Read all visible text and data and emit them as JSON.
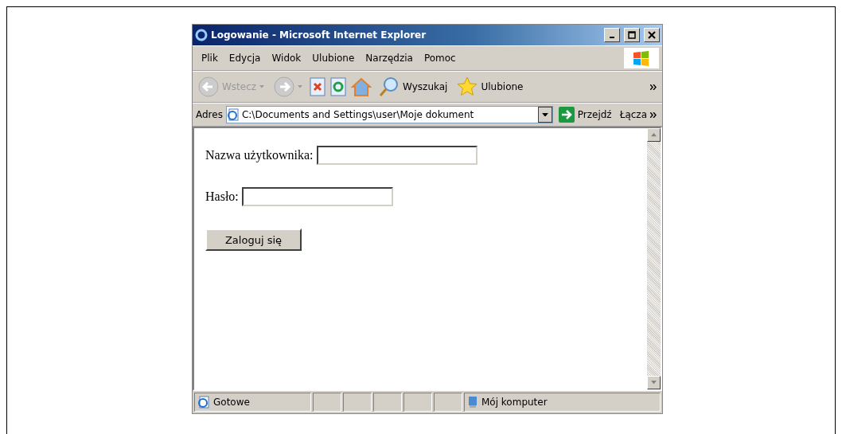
{
  "window": {
    "title": "Logowanie - Microsoft Internet Explorer"
  },
  "menu": [
    "Plik",
    "Edycja",
    "Widok",
    "Ulubione",
    "Narzędzia",
    "Pomoc"
  ],
  "toolbar": {
    "back": {
      "label": "Wstecz",
      "disabled": true
    },
    "forward": {
      "disabled": true
    },
    "search": "Wyszukaj",
    "favorites": "Ulubione"
  },
  "address": {
    "label": "Adres",
    "value": "C:\\Documents and Settings\\user\\Moje dokument",
    "go": "Przejdź",
    "links": "Łącza"
  },
  "form": {
    "fields": [
      {
        "label": "Nazwa użytkownika:",
        "kind": "text"
      },
      {
        "label": "Hasło:",
        "kind": "password"
      }
    ],
    "submit": "Zaloguj się"
  },
  "status_bar": {
    "status": "Gotowe",
    "zone": "Mój komputer"
  }
}
